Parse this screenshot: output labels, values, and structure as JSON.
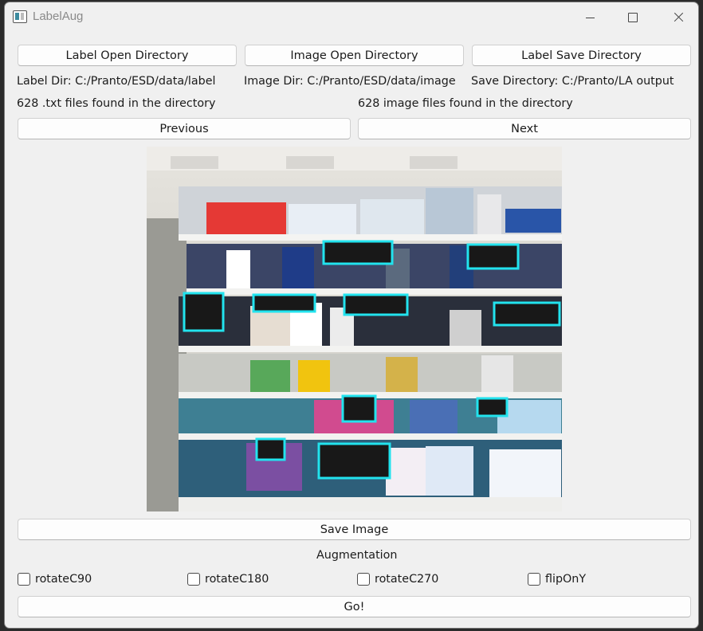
{
  "window": {
    "title": "LabelAug"
  },
  "buttons": {
    "label_open_dir": "Label Open Directory",
    "image_open_dir": "Image Open Directory",
    "label_save_dir": "Label Save Directory",
    "previous": "Previous",
    "next": "Next",
    "save_image": "Save Image",
    "go": "Go!"
  },
  "info": {
    "label_dir": "Label Dir: C:/Pranto/ESD/data/label",
    "image_dir": "Image Dir: C:/Pranto/ESD/data/image",
    "save_dir": "Save Directory: C:/Pranto/LA output",
    "txt_count": "628 .txt files found in the directory",
    "image_count": "628 image files found in the directory"
  },
  "augmentation": {
    "heading": "Augmentation",
    "options": [
      {
        "label": "rotateC90",
        "checked": false
      },
      {
        "label": "rotateC180",
        "checked": false
      },
      {
        "label": "rotateC270",
        "checked": false
      },
      {
        "label": "flipOnY",
        "checked": false
      }
    ]
  },
  "preview": {
    "description_icon": "store-shelf-photo",
    "box_color": "#22e3ee",
    "box_count": 11
  }
}
